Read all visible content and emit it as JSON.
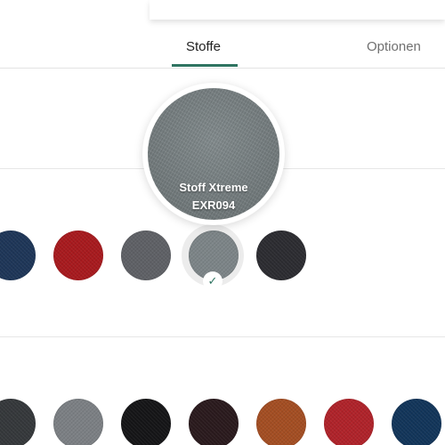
{
  "tabs": [
    {
      "label": "Stoffe",
      "active": true
    },
    {
      "label": "Optionen",
      "active": false
    }
  ],
  "preview": {
    "name": "Stoff Xtreme",
    "code": "EXR094",
    "color": "#7c8587"
  },
  "swatch_rows": [
    {
      "colors": [
        "#1e3658",
        "#a81a1e",
        "#5f6166",
        "#7d8588",
        "#2c2c31"
      ],
      "selected_index": 3
    },
    {
      "colors": [
        "#35383b",
        "#7c8084",
        "#151517",
        "#2a1a1d",
        "#a44e23",
        "#b0232a",
        "#12355a"
      ]
    }
  ],
  "icons": {
    "selected_check": "✓"
  },
  "colors": {
    "accent": "#2f7461"
  }
}
